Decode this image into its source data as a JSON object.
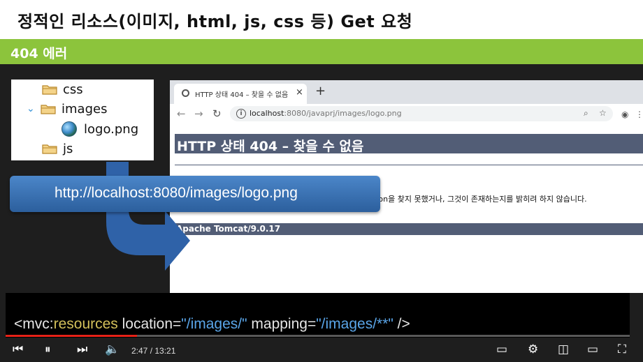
{
  "slide": {
    "title": "정적인 리소스(이미지, html, js, css 등) Get 요청",
    "section": "404 에러"
  },
  "file_tree": {
    "items": [
      {
        "label": "css",
        "type": "folder"
      },
      {
        "label": "images",
        "type": "folder",
        "expanded": true
      },
      {
        "label": "logo.png",
        "type": "file"
      },
      {
        "label": "js",
        "type": "folder"
      }
    ]
  },
  "browser": {
    "tab_title": "HTTP 상태 404 – 찾을 수 없음",
    "tab_close": "×",
    "new_tab": "+",
    "url_host": "localhost",
    "url_rest": ":8080/javaprj/images/logo.png",
    "page": {
      "heading": "HTTP 상태 404 – 찾을 수 없음",
      "message": "tation을 찾지 못했거나, 그것이 존재하는지를 밝히려 하지 않습니다.",
      "footer": "Apache Tomcat/9.0.17"
    }
  },
  "callout": {
    "text": "http://localhost:8080/images/logo.png"
  },
  "code": {
    "lt": "<",
    "ns": "mvc:",
    "tag": "resources",
    "attr1": " location=",
    "val1": "\"/images/\"",
    "attr2": " mapping=",
    "val2": "\"/images/**\"",
    "close": " />"
  },
  "player": {
    "time": "2:47 / 13:21",
    "progress": 0.21,
    "colors": {
      "progress": "#e62117"
    }
  },
  "colors": {
    "section_bar": "#8cc43c",
    "tomcat_header": "#525d76",
    "callout": "#2c5f9d"
  }
}
